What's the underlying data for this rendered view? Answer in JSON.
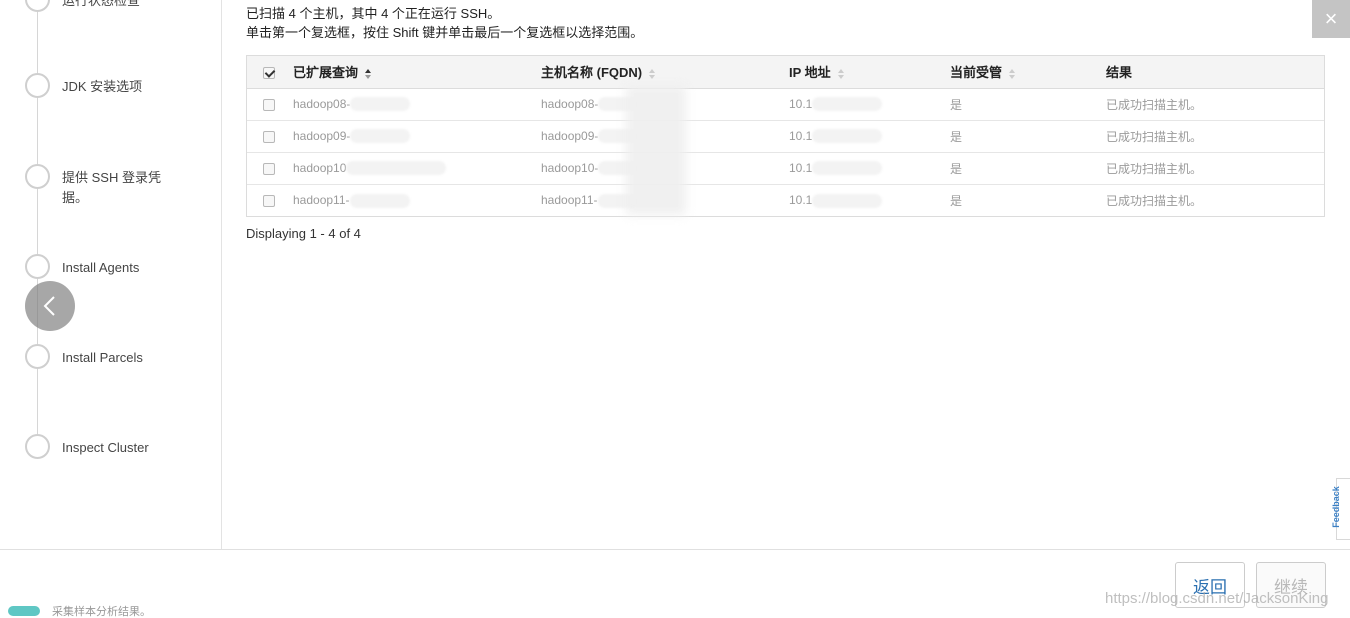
{
  "sidebar": {
    "steps": [
      {
        "label": "运行状态检查"
      },
      {
        "label": "JDK 安装选项"
      },
      {
        "label": "提供 SSH 登录凭据。"
      },
      {
        "label": "Install Agents"
      },
      {
        "label": "Install Parcels"
      },
      {
        "label": "Inspect Cluster"
      }
    ]
  },
  "info": {
    "line1": "已扫描 4 个主机，其中 4 个正在运行 SSH。",
    "line2": "单击第一个复选框，按住 Shift 键并单击最后一个复选框以选择范围。"
  },
  "table": {
    "columns": [
      "已扩展查询",
      "主机名称 (FQDN)",
      "IP 地址",
      "当前受管",
      "结果"
    ],
    "rows": [
      {
        "query": "hadoop08-",
        "fqdn": "hadoop08-",
        "ip": "10.1",
        "managed": "是",
        "result": "已成功扫描主机。"
      },
      {
        "query": "hadoop09-",
        "fqdn": "hadoop09-",
        "ip": "10.1",
        "managed": "是",
        "result": "已成功扫描主机。"
      },
      {
        "query": "hadoop10",
        "fqdn": "hadoop10-",
        "ip": "10.1",
        "managed": "是",
        "result": "已成功扫描主机。"
      },
      {
        "query": "hadoop11-",
        "fqdn": "hadoop11-",
        "ip": "10.1",
        "managed": "是",
        "result": "已成功扫描主机。"
      }
    ],
    "pagination": "Displaying 1 - 4 of 4"
  },
  "buttons": {
    "back": "返回",
    "next": "继续",
    "close": "×",
    "feedback": "Feedback"
  },
  "bottom_peek": "采集样本分析结果。",
  "watermark": "https://blog.csdn.net/JacksonKing",
  "colors": {
    "accent": "#2a6fb0",
    "muted_text": "#9a9a9a",
    "header_bg": "#f4f4f4"
  }
}
